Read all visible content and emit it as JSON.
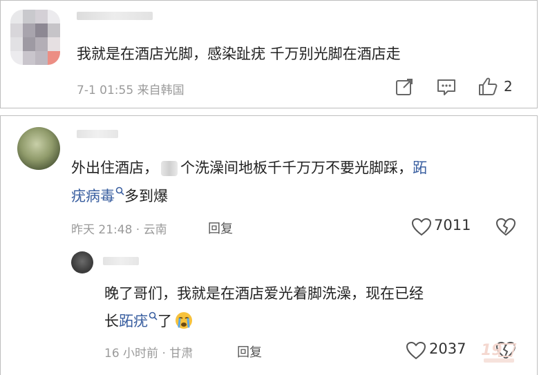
{
  "comment1": {
    "text": "我就是在酒店光脚，感染趾疣 千万别光脚在酒店走",
    "time_location": "7-1 01:55 来自韩国",
    "like_count": "2",
    "icons": [
      "share-icon",
      "comment-icon",
      "like-icon"
    ]
  },
  "comment2": {
    "text_line1_a": "外出住酒店，",
    "text_line1_b": "个洗澡间地板千千万万不要光脚踩，",
    "text_line1_link": "跖",
    "text_line2_link": "疣病毒",
    "text_line2_rest": "多到爆",
    "time_location": "昨天 21:48 · 云南",
    "reply_label": "回复",
    "like_count": "7011",
    "icons": [
      "search-icon",
      "heart-icon",
      "broken-heart-icon"
    ]
  },
  "reply1": {
    "text_line1": "晚了哥们，我就是在酒店爱光着脚洗澡，现在已经",
    "text_line2_a": "长",
    "text_line2_link": "跖疣",
    "text_line2_b": "了",
    "time_location": "16 小时前 · 甘肃",
    "reply_label": "回复",
    "like_count": "2037",
    "icons": [
      "search-icon",
      "crying-emoji-icon",
      "heart-icon",
      "broken-heart-icon"
    ]
  },
  "colors": {
    "link": "#3a5fa0",
    "meta": "#9a9a9a",
    "border": "#bdbdbd"
  }
}
